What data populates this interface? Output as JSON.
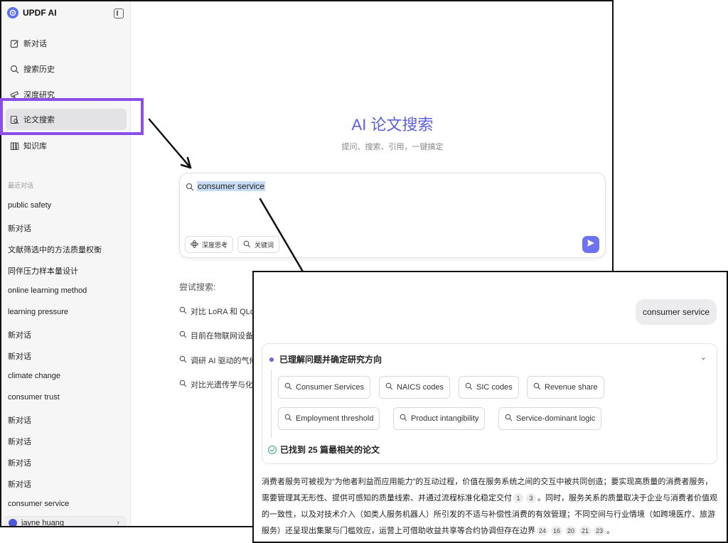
{
  "app": {
    "name": "UPDF AI"
  },
  "sidebar": {
    "nav": [
      {
        "label": "新对话",
        "icon": "edit-icon"
      },
      {
        "label": "搜索历史",
        "icon": "search-icon"
      },
      {
        "label": "深度研究",
        "icon": "telescope-icon"
      },
      {
        "label": "论文搜索",
        "icon": "paper-search-icon",
        "active": true
      },
      {
        "label": "知识库",
        "icon": "library-icon"
      }
    ],
    "recent_label": "最近对话",
    "recent": [
      "public safety",
      "新对话",
      "文献筛选中的方法质量权衡",
      "同伴压力样本量设计",
      "online learning method",
      "learning pressure",
      "新对话",
      "新对话",
      "climate change",
      "consumer trust",
      "新对话",
      "新对话",
      "新对话",
      "新对话",
      "consumer service"
    ],
    "user_name": "jayne huang"
  },
  "main": {
    "title": "AI 论文搜索",
    "subtitle": "提问、搜索、引用，一键搞定",
    "search": {
      "value": "consumer service",
      "deep_think_label": "深度思考",
      "keyword_label": "关键词"
    },
    "try_label": "尝试搜索:",
    "suggestions": [
      "对比 LoRA 和 QLo",
      "目前在物联网设备上",
      "调研 AI 驱动的气候",
      "对比光遗传学与化学"
    ]
  },
  "result": {
    "query": "consumer service",
    "process_title": "已理解问题并确定研究方向",
    "chips": [
      "Consumer Services",
      "NAICS codes",
      "SIC codes",
      "Revenue share",
      "Employment threshold",
      "Product intangibility",
      "Service-dominant logic"
    ],
    "found_label": "已找到 25 篇最相关的论文",
    "answer": {
      "p1": "消费者服务可被视为“为他者利益而应用能力”的互动过程，价值在服务系统之间的交互中被共同创造；要实现高质量的消费者服务，需要管理其无形性、提供可感知的质量线索、并通过流程标准化稳定交付",
      "cites1": [
        "1",
        "3"
      ],
      "p2": "。同时，服务关系的质量取决于企业与消费者价值观的一致性，以及对技术介入（如类人服务机器人）所引发的不适与补偿性消费的有效管理；不同空间与行业情境（如跨境医疗、旅游服务）还呈现出集聚与门槛效应，运营上可借助收益共享等合约协调但存在边界",
      "cites2": [
        "24",
        "16",
        "20",
        "21",
        "23"
      ],
      "p3": "。"
    }
  },
  "colors": {
    "accent": "#5b5fe3",
    "highlight_box": "#8c4ee8",
    "send_button": "#6c72f0",
    "check": "#2faa6a"
  }
}
